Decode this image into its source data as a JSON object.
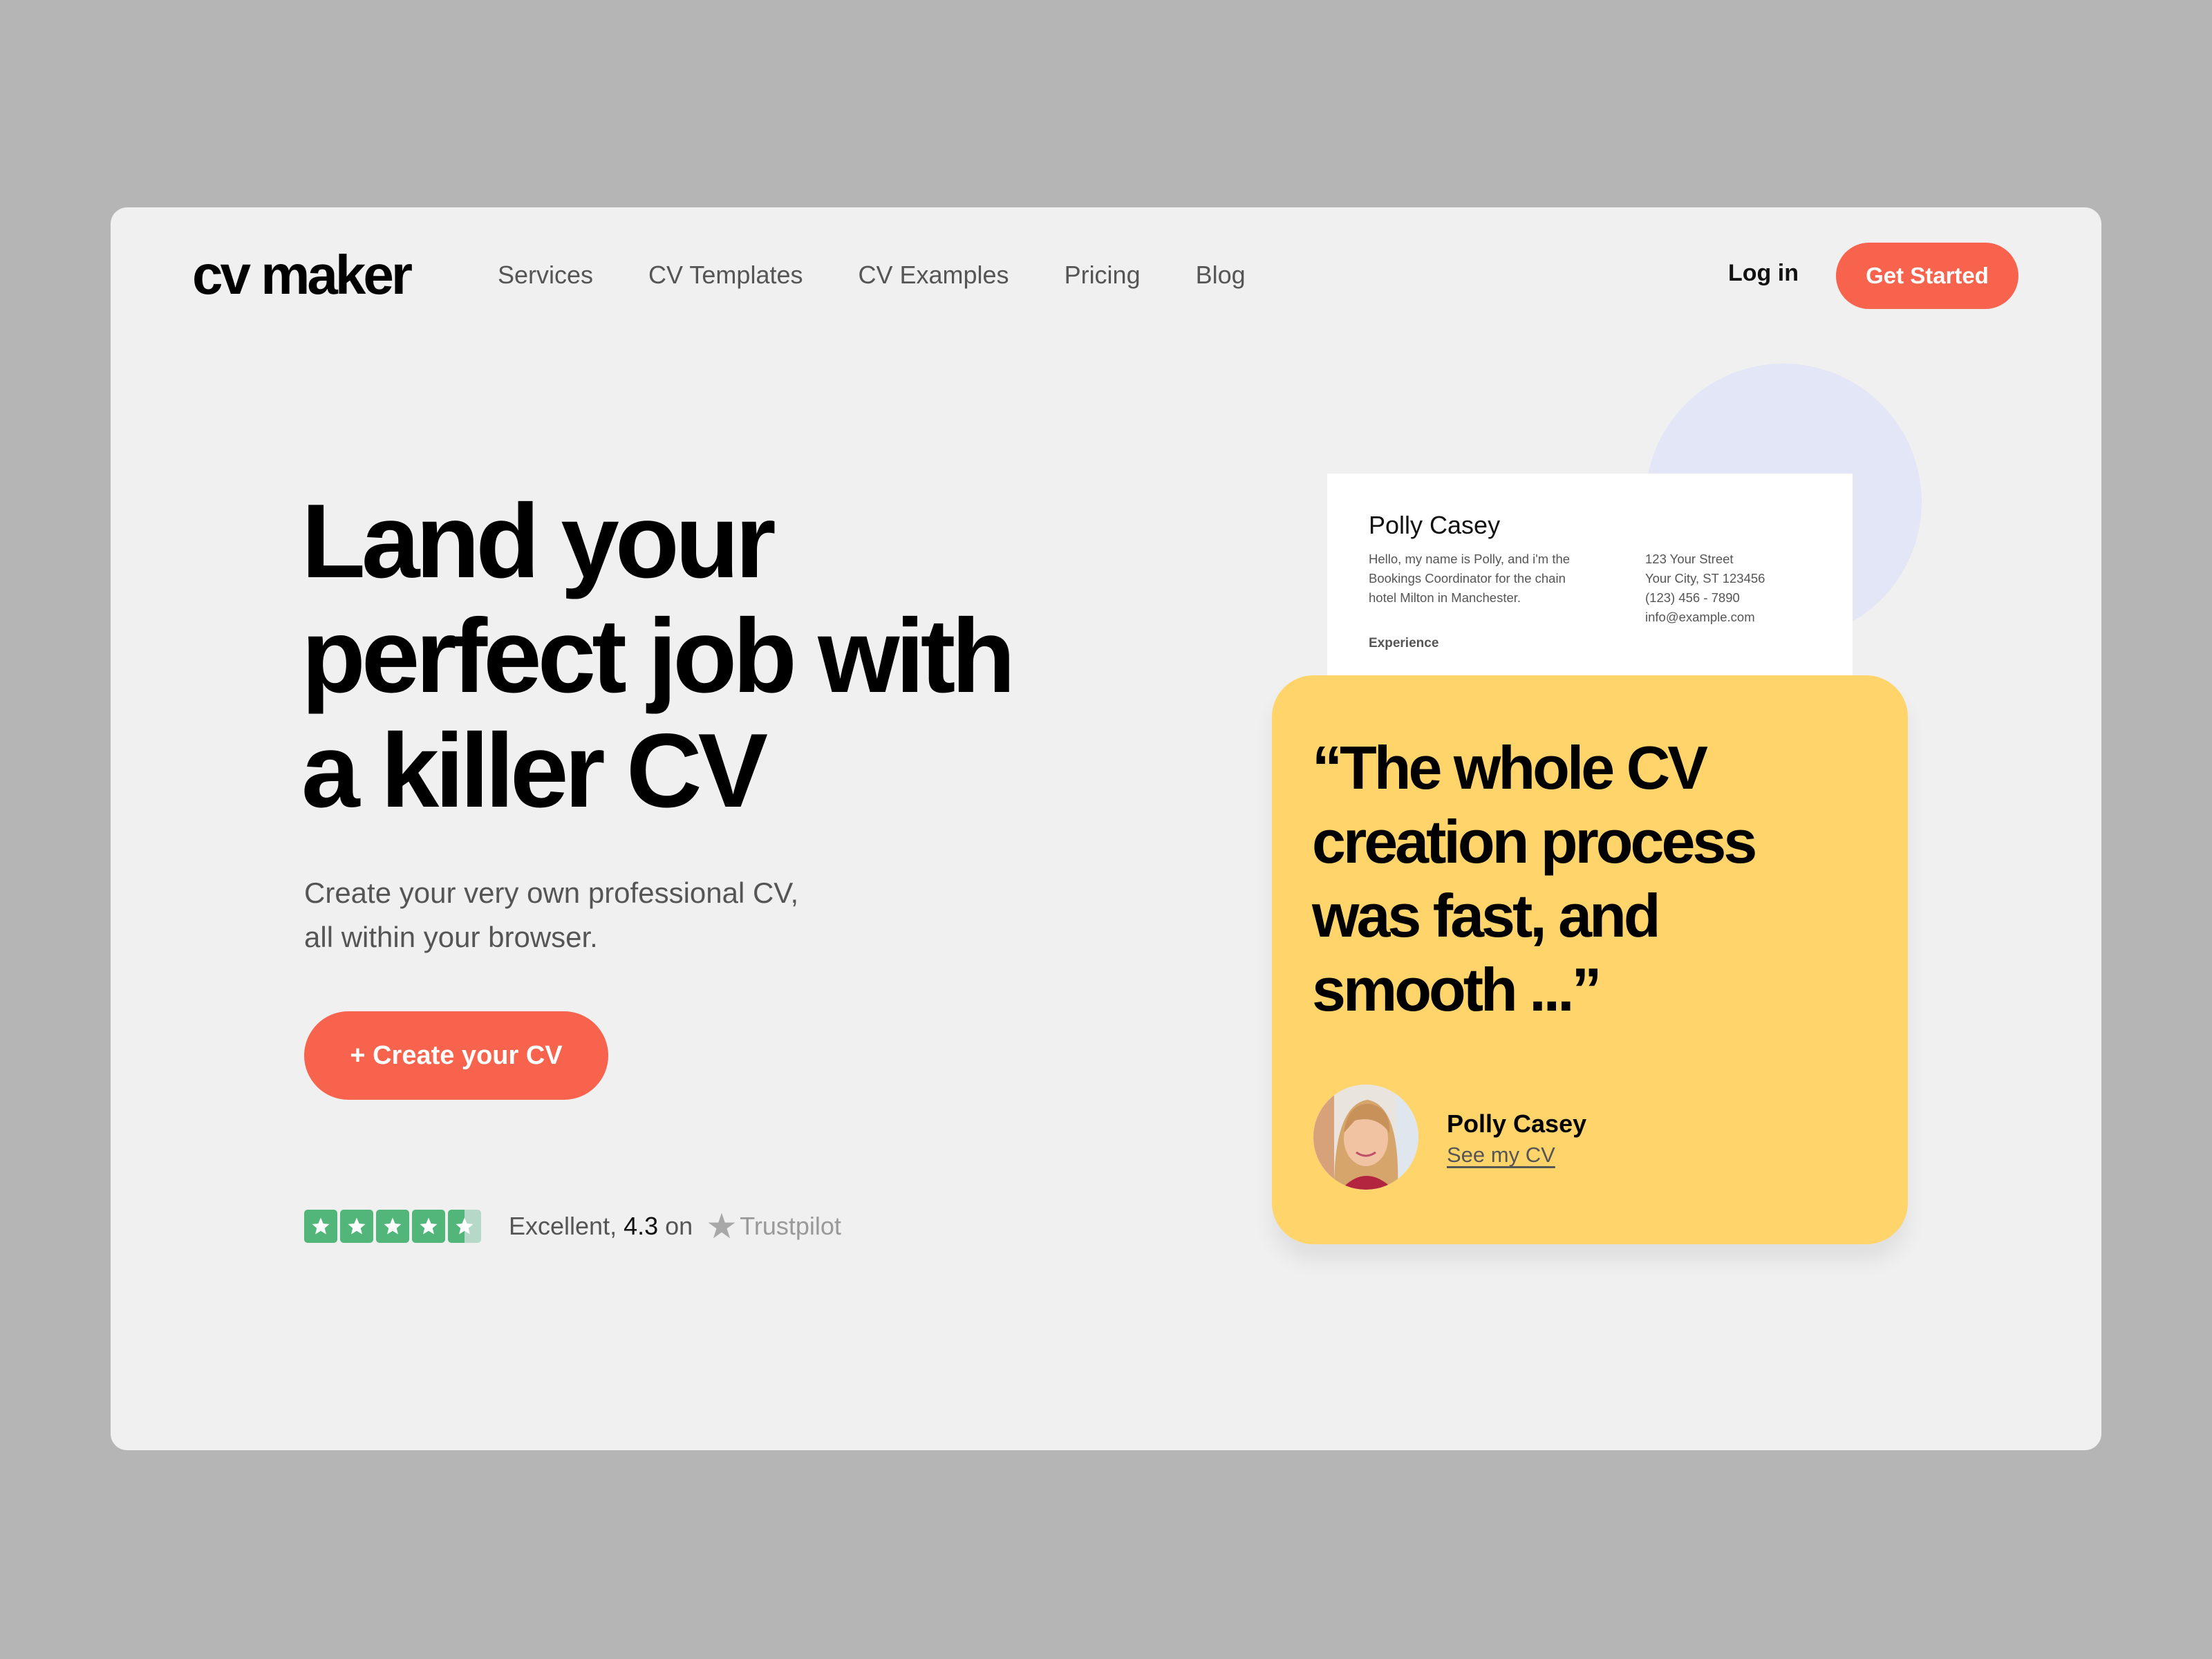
{
  "brand": {
    "logo": "cv maker"
  },
  "nav": {
    "items": [
      "Services",
      "CV Templates",
      "CV Examples",
      "Pricing",
      "Blog"
    ],
    "login_label": "Log in",
    "cta_label": "Get Started"
  },
  "hero": {
    "headline_lines": [
      "Land your",
      "perfect job with",
      "a killer CV"
    ],
    "subtitle_lines": [
      "Create your very own professional CV,",
      "all within your browser."
    ],
    "cta_label": "+ Create your CV"
  },
  "rating": {
    "stars_total": 5,
    "stars_value": 4.5,
    "text": "Excellent,",
    "score": "4.3",
    "on": "on",
    "provider": "Trustpilot"
  },
  "cv_preview": {
    "name": "Polly Casey",
    "bio_lines": [
      "Hello, my name is Polly, and i'm the",
      "Bookings Coordinator for the chain",
      "hotel Milton in Manchester."
    ],
    "contact_lines": [
      "123 Your Street",
      "Your City, ST 123456",
      "(123) 456 - 7890",
      "info@example.com"
    ],
    "section_label": "Experience"
  },
  "testimonial": {
    "quote_lines": [
      "“The whole CV",
      "creation process",
      "was fast, and",
      "smooth ...”"
    ],
    "author_name": "Polly Casey",
    "author_link": "See my CV"
  },
  "colors": {
    "accent": "#f7634d",
    "card_yellow": "#ffd56b",
    "circle": "#e2e6f7",
    "trustpilot_green": "#52b67b",
    "page_bg": "#f0f0f0",
    "outer_bg": "#b5b5b5"
  }
}
